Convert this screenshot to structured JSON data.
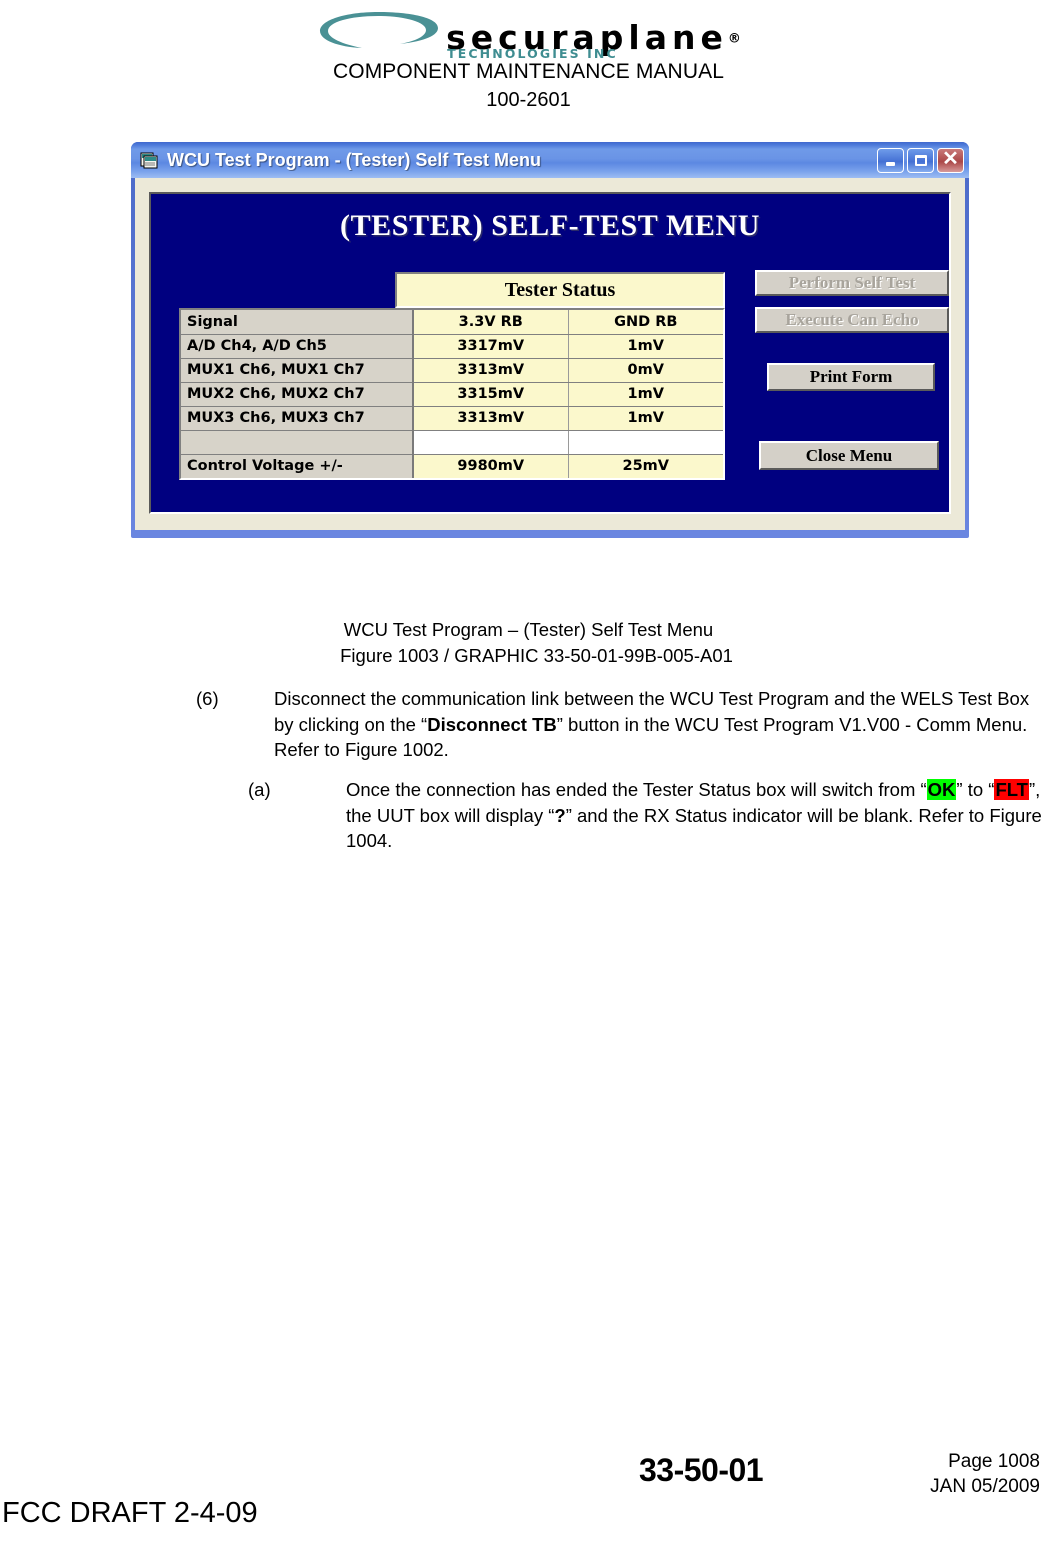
{
  "page_header": {
    "brand_name": "securaplane",
    "brand_reg": "®",
    "brand_sub": "TECHNOLOGIES INC",
    "manual_title": "COMPONENT MAINTENANCE MANUAL",
    "manual_number": "100-2601",
    "logo_icon": "swoosh-logo-icon"
  },
  "window": {
    "title": "WCU Test Program - (Tester) Self Test Menu",
    "icon": "form-document-icon",
    "minimize_label": "Minimize",
    "maximize_label": "Maximize",
    "close_label": "Close",
    "app": {
      "title": "(TESTER) SELF-TEST MENU",
      "status_header": "Tester Status",
      "table": {
        "columns": [
          "Signal",
          "3.3V RB",
          "GND RB"
        ],
        "rows": [
          {
            "label": "A/D Ch4, A/D Ch5",
            "v1": "3317mV",
            "v2": "1mV",
            "blank": false
          },
          {
            "label": "MUX1 Ch6, MUX1 Ch7",
            "v1": "3313mV",
            "v2": "0mV",
            "blank": false
          },
          {
            "label": "MUX2 Ch6, MUX2 Ch7",
            "v1": "3315mV",
            "v2": "1mV",
            "blank": false
          },
          {
            "label": "MUX3 Ch6, MUX3 Ch7",
            "v1": "3313mV",
            "v2": "1mV",
            "blank": false
          },
          {
            "label": "",
            "v1": "",
            "v2": "",
            "blank": true
          },
          {
            "label": "Control Voltage +/-",
            "v1": "9980mV",
            "v2": "25mV",
            "blank": false
          }
        ]
      },
      "buttons": {
        "perform_self_test": "Perform Self Test",
        "execute_can_echo": "Execute Can Echo",
        "print_form": "Print Form",
        "close_menu": "Close Menu"
      },
      "colors": {
        "panel_bg": "#000080",
        "cell_yellow": "#fbf8cc",
        "dialog_bg": "#ece9d8"
      }
    }
  },
  "figure_caption": {
    "line1": "WCU Test Program – (Tester) Self Test Menu",
    "line2": "Figure 1003 / GRAPHIC 33-50-01-99B-005-A01"
  },
  "steps": {
    "step6": {
      "marker": "(6)",
      "text_1": "Disconnect the communication link between the WCU Test Program and the WELS Test Box by clicking on the “",
      "bold_1": "Disconnect TB",
      "text_2": "” button in the WCU Test Program V1.V00 - Comm Menu. Refer to Figure 1002."
    },
    "step6a": {
      "marker": "(a)",
      "text_1": "Once the connection has ended the Tester Status box will switch from “",
      "hl_ok": "OK",
      "text_2": "” to “",
      "hl_flt": "FLT",
      "text_3": "”, the UUT box will display “",
      "bold_q": "?",
      "text_4": "” and the RX Status indicator will be blank. Refer to Figure 1004.",
      "highlight_ok_color": "#00ff00",
      "highlight_flt_color": "#ff0000"
    }
  },
  "footer": {
    "ata_number": "33-50-01",
    "page": "Page 1008",
    "date": "JAN 05/2009",
    "draft": "FCC DRAFT 2-4-09"
  }
}
